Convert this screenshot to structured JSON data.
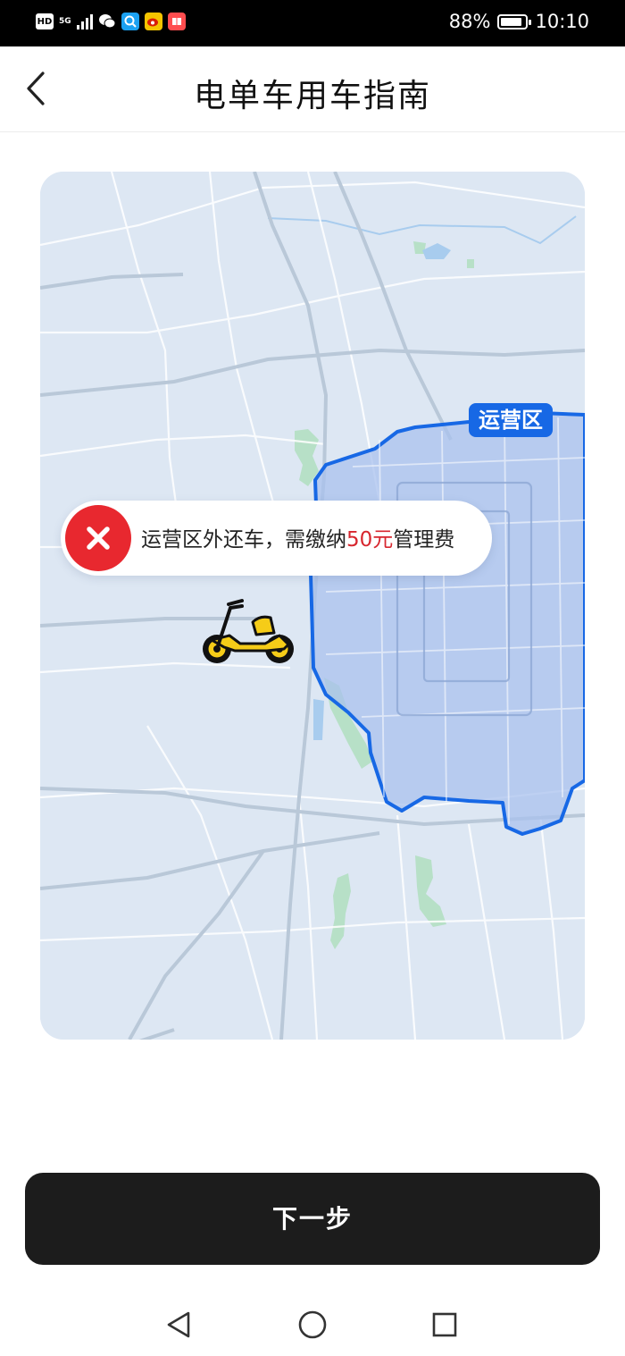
{
  "status_bar": {
    "hd_label": "HD",
    "network_label": "5G",
    "app_icons": [
      "wechat-icon",
      "qq-browser-icon",
      "weibo-icon",
      "reader-icon"
    ],
    "battery_percent": "88%",
    "battery_level": 0.88,
    "time": "10:10"
  },
  "header": {
    "title": "电单车用车指南",
    "back_icon": "chevron-left-icon"
  },
  "map": {
    "zone_label": "运营区",
    "zone_color": "#1768e5",
    "notice": {
      "text_before": "运营区外还车，需缴纳",
      "fee_amount": "50元",
      "text_after": "管理费",
      "icon": "close-icon",
      "fee_color": "#d7262e"
    },
    "vehicle_icon": "scooter-icon"
  },
  "footer": {
    "next_label": "下一步"
  },
  "system_nav": {
    "back_icon": "triangle-back-icon",
    "home_icon": "circle-home-icon",
    "recents_icon": "square-recents-icon"
  }
}
